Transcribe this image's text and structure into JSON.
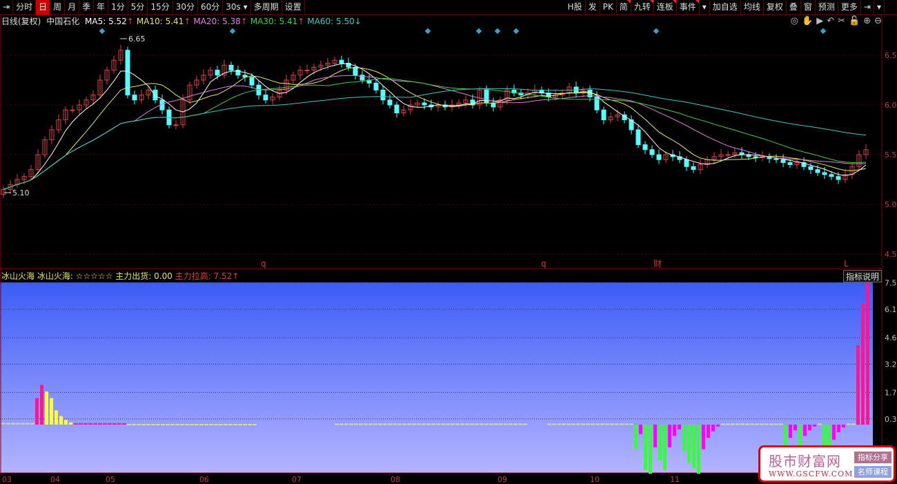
{
  "toolbar": {
    "left": [
      "分时",
      "日",
      "周",
      "月",
      "季",
      "年",
      "1分",
      "5分",
      "15分",
      "30分",
      "60分",
      "30s ▾",
      "多周期",
      "设置"
    ],
    "selected": "日",
    "right": [
      "H股",
      "发",
      "PK",
      "简",
      "九转",
      "连板",
      "事件",
      "▾",
      "加自选",
      "均线",
      "复权",
      "叠",
      "窗",
      "预测",
      "更多",
      "⇥",
      "▾"
    ],
    "flagged": [
      "简",
      "九转",
      "连板",
      "事件"
    ]
  },
  "legend": {
    "period": "日线(复权)",
    "stock": "中国石化",
    "ma": [
      {
        "label": "MA5: 5.52",
        "arrow": "↑",
        "color": "#ffffff"
      },
      {
        "label": "MA10: 5.41",
        "arrow": "↑",
        "color": "#e8e860"
      },
      {
        "label": "MA20: 5.38",
        "arrow": "↑",
        "color": "#e080e0"
      },
      {
        "label": "MA30: 5.41",
        "arrow": "↑",
        "color": "#40d040"
      },
      {
        "label": "MA60: 5.50",
        "arrow": "↓",
        "color": "#40c8c8"
      }
    ]
  },
  "tools": [
    "eye-icon",
    "hand-icon",
    "play-icon",
    "undo-icon",
    "scissors-icon",
    "lock-icon",
    "zoom-in-icon",
    "zoom-out-icon"
  ],
  "sub_legend": {
    "name": "冰山火海",
    "line1": "冰山火海: ☆☆☆☆☆ 主力出货: 0.00",
    "line2": "主力拉高: 7.52↑",
    "explain_button": "指标说明"
  },
  "watermark": {
    "title": "股市财富网",
    "url": "WWW.GSCFW.COM",
    "tag1": "指标分享",
    "tag2": "名师课程"
  },
  "colors": {
    "up": "#e04040",
    "down": "#54ffff",
    "grid": "#5a0000",
    "p": "#ff1493",
    "y": "#ffff33",
    "g": "#33ff33",
    "m": "#ff00ff",
    "n": "#d8d8a0"
  },
  "chart_data": [
    {
      "type": "candlestick",
      "title": "中国石化",
      "ylim": [
        4.45,
        6.65
      ],
      "yticks": [
        "6.5",
        "6.0",
        "5.5",
        "5.0",
        "4.5"
      ],
      "annotations": [
        {
          "label": "6.65",
          "kind": "high"
        },
        {
          "label": "5.10",
          "kind": "low"
        }
      ],
      "event_markers": [
        "q",
        "q",
        "财",
        "L"
      ],
      "closes": [
        5.15,
        5.2,
        5.25,
        5.28,
        5.35,
        5.5,
        5.65,
        5.75,
        5.85,
        5.95,
        5.95,
        6.0,
        6.05,
        6.1,
        6.25,
        6.35,
        6.45,
        6.55,
        6.1,
        6.05,
        6.1,
        6.15,
        6.05,
        5.95,
        5.8,
        5.8,
        6.05,
        6.2,
        6.25,
        6.3,
        6.35,
        6.3,
        6.4,
        6.35,
        6.3,
        6.28,
        6.2,
        6.1,
        6.05,
        6.08,
        6.15,
        6.25,
        6.3,
        6.35,
        6.35,
        6.38,
        6.4,
        6.42,
        6.45,
        6.42,
        6.38,
        6.3,
        6.25,
        6.22,
        6.15,
        6.05,
        6.0,
        5.92,
        5.95,
        6.0,
        6.02,
        6.0,
        5.98,
        6.0,
        5.98,
        6.0,
        6.02,
        6.05,
        6.0,
        6.15,
        6.02,
        5.98,
        6.05,
        6.15,
        6.12,
        6.1,
        6.12,
        6.15,
        6.12,
        6.08,
        6.1,
        6.12,
        6.18,
        6.12,
        6.15,
        6.08,
        5.95,
        5.85,
        5.88,
        5.9,
        5.85,
        5.75,
        5.6,
        5.55,
        5.5,
        5.45,
        5.5,
        5.48,
        5.45,
        5.38,
        5.35,
        5.4,
        5.45,
        5.48,
        5.5,
        5.5,
        5.52,
        5.5,
        5.48,
        5.47,
        5.48,
        5.46,
        5.45,
        5.42,
        5.4,
        5.42,
        5.38,
        5.35,
        5.32,
        5.3,
        5.28,
        5.25,
        5.3,
        5.38,
        5.5,
        5.55
      ],
      "ma_periods": [
        5,
        10,
        20,
        30,
        60
      ],
      "xticks": [
        "03",
        "04",
        "05",
        "06",
        "07",
        "08",
        "09",
        "10",
        "11"
      ]
    },
    {
      "type": "bar",
      "title": "冰山火海",
      "ylim": [
        -1.1,
        7.52
      ],
      "yticks": [
        "7.5",
        "6.1",
        "4.6",
        "3.2",
        "1.7",
        "0.3"
      ],
      "runs": [
        [
          0.05,
          "n",
          7
        ],
        [
          1.4,
          "p",
          1
        ],
        [
          2.1,
          "p",
          1
        ],
        [
          1.75,
          "y",
          1
        ],
        [
          1.4,
          "y",
          1
        ],
        [
          0.75,
          "y",
          1
        ],
        [
          0.45,
          "y",
          1
        ],
        [
          0.25,
          "y",
          1
        ],
        [
          0.12,
          "y",
          1
        ],
        [
          0.04,
          "p",
          11
        ],
        [
          0.0,
          "n",
          27
        ],
        [
          null,
          "n",
          16
        ],
        [
          0.02,
          "n",
          40
        ],
        [
          null,
          "n",
          4
        ],
        [
          0.02,
          "n",
          18
        ],
        [
          -1.3,
          "g",
          1
        ],
        [
          -0.5,
          "m",
          1
        ],
        [
          -2.4,
          "g",
          1
        ],
        [
          -2.6,
          "g",
          1
        ],
        [
          -1.2,
          "m",
          1
        ],
        [
          -1.9,
          "g",
          1
        ],
        [
          -2.4,
          "g",
          1
        ],
        [
          -1.2,
          "m",
          1
        ],
        [
          -0.6,
          "m",
          1
        ],
        [
          -0.25,
          "m",
          1
        ],
        [
          -1.4,
          "g",
          1
        ],
        [
          -2.0,
          "g",
          1
        ],
        [
          -2.3,
          "g",
          1
        ],
        [
          -2.6,
          "g",
          1
        ],
        [
          -1.3,
          "m",
          1
        ],
        [
          -0.7,
          "m",
          1
        ],
        [
          -0.35,
          "m",
          1
        ],
        [
          -0.1,
          "m",
          1
        ],
        [
          0.02,
          "n",
          13
        ],
        [
          -1.3,
          "g",
          1
        ],
        [
          -0.7,
          "m",
          1
        ],
        [
          -0.3,
          "m",
          1
        ],
        [
          -1.3,
          "g",
          1
        ],
        [
          -0.6,
          "m",
          1
        ],
        [
          -0.3,
          "m",
          1
        ],
        [
          -0.1,
          "m",
          1
        ],
        [
          0.02,
          "n",
          1
        ],
        [
          -1.3,
          "g",
          1
        ],
        [
          -1.3,
          "g",
          1
        ],
        [
          -0.8,
          "m",
          1
        ],
        [
          -0.4,
          "m",
          1
        ],
        [
          -0.15,
          "m",
          1
        ],
        [
          0.02,
          "n",
          2
        ],
        [
          4.2,
          "p",
          1
        ],
        [
          6.4,
          "p",
          1
        ],
        [
          7.52,
          "p",
          1
        ]
      ]
    }
  ]
}
